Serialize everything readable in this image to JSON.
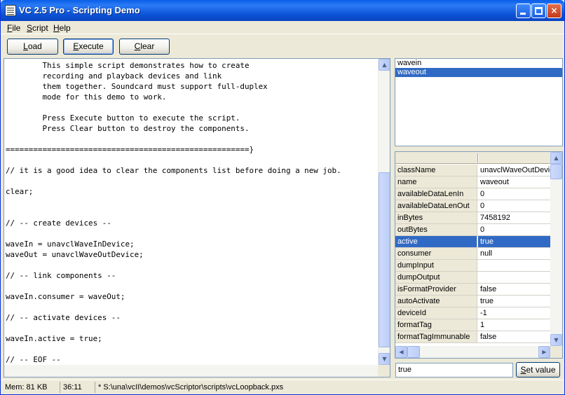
{
  "window": {
    "title": "VC 2.5 Pro - Scripting Demo",
    "controls": {
      "minimize": "minimize",
      "maximize": "maximize",
      "close": "×"
    }
  },
  "menu": {
    "file": "File",
    "script": "Script",
    "help": "Help"
  },
  "toolbar": {
    "load_label": "Load",
    "execute_label": "Execute",
    "clear_label": "Clear"
  },
  "editor": {
    "lines": [
      "        This simple script demonstrates how to create",
      "        recording and playback devices and link",
      "        them together. Soundcard must support full-duplex",
      "        mode for this demo to work.",
      "",
      "        Press Execute button to execute the script.",
      "        Press Clear button to destroy the components.",
      "",
      "=====================================================}",
      "",
      "// it is a good idea to clear the components list before doing a new job.",
      "",
      "clear;",
      "",
      "",
      "// -- create devices --",
      "",
      "waveIn = unavclWaveInDevice;",
      "waveOut = unavclWaveOutDevice;",
      "",
      "// -- link components --",
      "",
      "waveIn.consumer = waveOut;",
      "",
      "// -- activate devices --",
      "",
      "waveIn.active = true;",
      "",
      "// -- EOF --"
    ]
  },
  "components": {
    "items": [
      "wavein",
      "waveout"
    ],
    "selected": "waveout"
  },
  "properties": {
    "rows": [
      {
        "name": "className",
        "value": "unavclWaveOutDevice"
      },
      {
        "name": "name",
        "value": "waveout"
      },
      {
        "name": "availableDataLenIn",
        "value": "0"
      },
      {
        "name": "availableDataLenOut",
        "value": "0"
      },
      {
        "name": "inBytes",
        "value": "7458192"
      },
      {
        "name": "outBytes",
        "value": "0"
      },
      {
        "name": "active",
        "value": "true"
      },
      {
        "name": "consumer",
        "value": "null"
      },
      {
        "name": "dumpInput",
        "value": ""
      },
      {
        "name": "dumpOutput",
        "value": ""
      },
      {
        "name": "isFormatProvider",
        "value": "false"
      },
      {
        "name": "autoActivate",
        "value": "true"
      },
      {
        "name": "deviceId",
        "value": "-1"
      },
      {
        "name": "formatTag",
        "value": "1"
      },
      {
        "name": "formatTagImmunable",
        "value": "false"
      }
    ],
    "selected": "active"
  },
  "value_editor": {
    "value": "true",
    "set_label": "Set value"
  },
  "status": {
    "memory": "Mem: 81 KB",
    "position": "36:11",
    "file": "*  S:\\una\\vcII\\demos\\vcScriptor\\scripts\\vcLoopback.pxs"
  }
}
